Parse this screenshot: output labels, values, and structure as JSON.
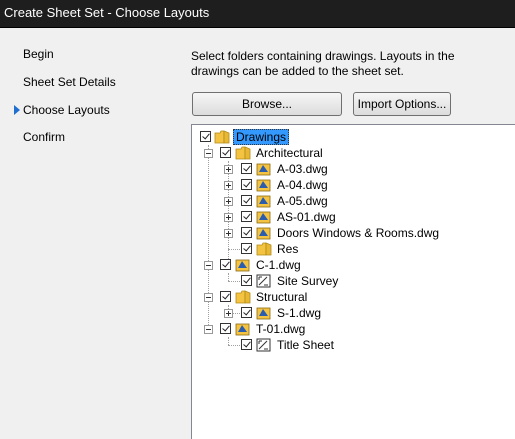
{
  "window": {
    "title": "Create Sheet Set - Choose Layouts"
  },
  "steps": [
    {
      "label": "Begin",
      "current": false
    },
    {
      "label": "Sheet Set Details",
      "current": false
    },
    {
      "label": "Choose Layouts",
      "current": true
    },
    {
      "label": "Confirm",
      "current": false
    }
  ],
  "instructions": "Select folders containing drawings.  Layouts in the drawings can be added to the sheet set.",
  "buttons": {
    "browse": "Browse...",
    "import_options": "Import Options..."
  },
  "tree": {
    "root": "Drawings",
    "architectural": "Architectural",
    "a03": "A-03.dwg",
    "a04": "A-04.dwg",
    "a05": "A-05.dwg",
    "as01": "AS-01.dwg",
    "doors": "Doors Windows & Rooms.dwg",
    "res": "Res",
    "c1": "C-1.dwg",
    "site_survey": "Site Survey",
    "structural": "Structural",
    "s1": "S-1.dwg",
    "t01": "T-01.dwg",
    "title_sheet": "Title Sheet"
  },
  "colors": {
    "accent": "#1f6fd1",
    "selection": "#3399ff",
    "folder": "#f5c342"
  }
}
